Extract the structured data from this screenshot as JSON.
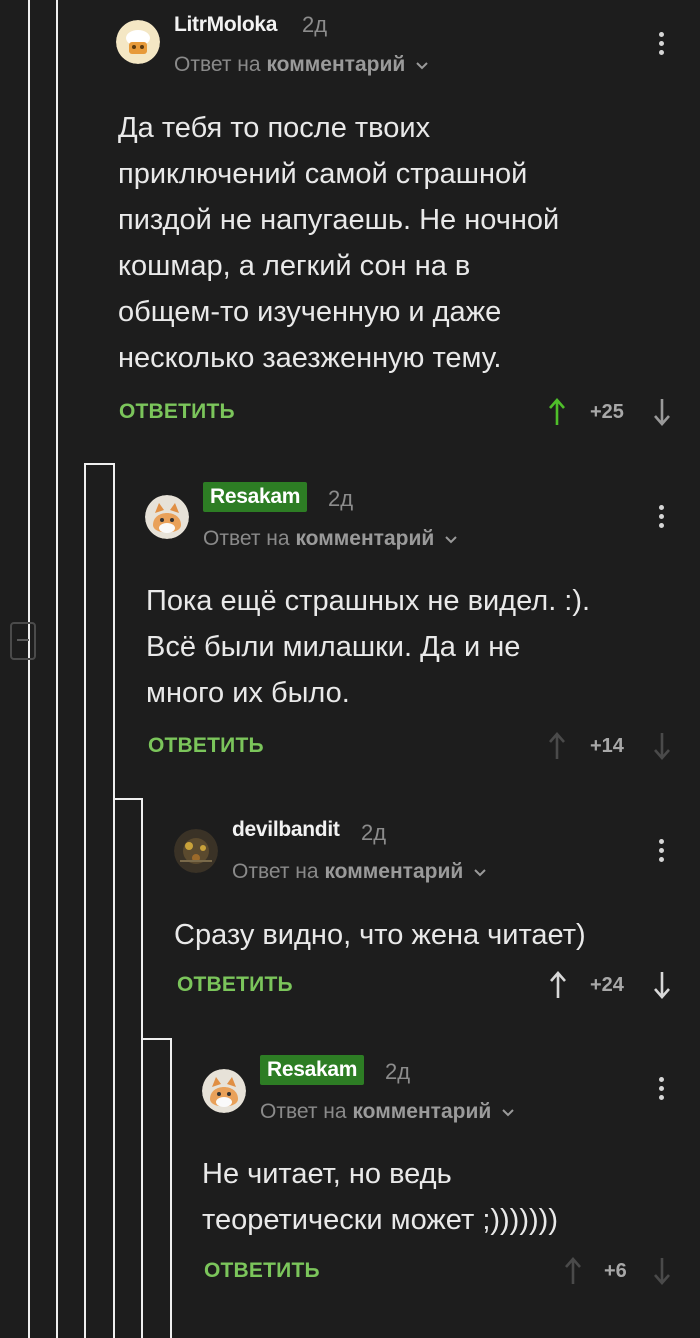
{
  "comments": [
    {
      "author": "LitrMoloka",
      "time": "2д",
      "reply_prefix": "Ответ на",
      "reply_target": "комментарий",
      "text_lines": [
        "Да тебя то после твоих",
        "приключений самой страшной",
        "пиздой не напугаешь. Не ночной",
        "кошмар, а легкий сон на в",
        "общем-то изученную и даже",
        "несколько заезженную тему."
      ],
      "reply_label": "ОТВЕТИТЬ",
      "rating": "+25",
      "upvoted": true
    },
    {
      "author": "Resakam",
      "time": "2д",
      "reply_prefix": "Ответ на",
      "reply_target": "комментарий",
      "text_lines": [
        "Пока ещё страшных не видел. :).",
        "Всё были милашки. Да и не",
        "много их было."
      ],
      "reply_label": "ОТВЕТИТЬ",
      "rating": "+14",
      "upvoted": false
    },
    {
      "author": "devilbandit",
      "time": "2д",
      "reply_prefix": "Ответ на",
      "reply_target": "комментарий",
      "text_lines": [
        "Сразу видно, что жена читает)"
      ],
      "reply_label": "ОТВЕТИТЬ",
      "rating": "+24",
      "upvoted": true
    },
    {
      "author": "Resakam",
      "time": "2д",
      "reply_prefix": "Ответ на",
      "reply_target": "комментарий",
      "text_lines": [
        "Не читает, но ведь",
        "теоретически может ;)))))))"
      ],
      "reply_label": "ОТВЕТИТЬ",
      "rating": "+6",
      "upvoted": false
    }
  ],
  "colors": {
    "background": "#1d1d1d",
    "accent_green": "#7bc55b",
    "badge_green": "#2d7d24"
  },
  "icons": [
    "kebab-menu-icon",
    "chevron-down-icon",
    "arrow-up-icon",
    "arrow-down-icon",
    "collapse-thread-icon"
  ]
}
